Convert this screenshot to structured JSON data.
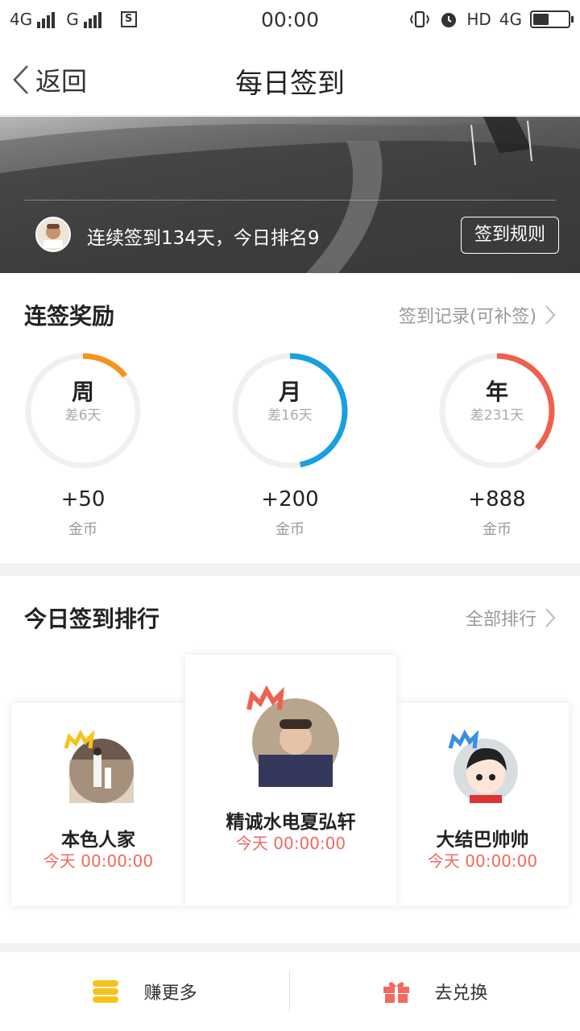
{
  "status_bar": {
    "network1": "4G",
    "network2": "G",
    "time": "00:00",
    "hd": "HD",
    "net_right": "4G"
  },
  "nav": {
    "back_label": "返回",
    "title": "每日签到"
  },
  "banner": {
    "streak_text": "连续签到134天，今日排名9",
    "rules_button": "签到规则"
  },
  "rewards": {
    "title": "连签奖励",
    "record_link": "签到记录(可补签)",
    "items": [
      {
        "label": "周",
        "remaining": "差6天",
        "amount": "+50",
        "unit": "金币",
        "color": "#f5931f",
        "progress": 0.14
      },
      {
        "label": "月",
        "remaining": "差16天",
        "amount": "+200",
        "unit": "金币",
        "color": "#1a9fe0",
        "progress": 0.47
      },
      {
        "label": "年",
        "remaining": "差231天",
        "amount": "+888",
        "unit": "金币",
        "color": "#f0604e",
        "progress": 0.37
      }
    ]
  },
  "ranking": {
    "title": "今日签到排行",
    "all_link": "全部排行",
    "entries": [
      {
        "rank": 2,
        "name": "本色人家",
        "time": "今天 00:00:00",
        "crown_color": "#f7c21a"
      },
      {
        "rank": 1,
        "name": "精诚水电夏弘轩",
        "time": "今天 00:00:00",
        "crown_color": "#f0604e"
      },
      {
        "rank": 3,
        "name": "大结巴帅帅",
        "time": "今天 00:00:00",
        "crown_color": "#3b8fe0"
      }
    ]
  },
  "bottom": {
    "earn_more": "赚更多",
    "redeem": "去兑换",
    "earn_icon_color": "#f7c21a",
    "redeem_icon_color": "#f06a5f"
  }
}
